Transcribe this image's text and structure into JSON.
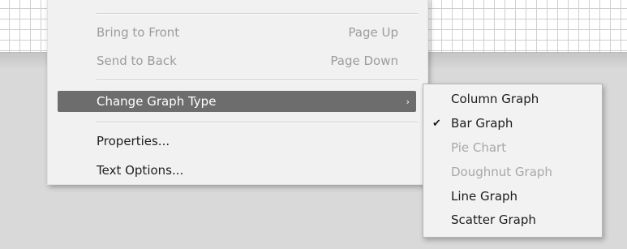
{
  "context_menu": {
    "items": [
      {
        "label": "Bring to Front",
        "shortcut": "Page Up",
        "enabled": false
      },
      {
        "label": "Send to Back",
        "shortcut": "Page Down",
        "enabled": false
      },
      {
        "label": "Change Graph Type",
        "shortcut": "",
        "enabled": true,
        "highlighted": true,
        "submenu_arrow": "›"
      },
      {
        "label": "Properties...",
        "shortcut": "",
        "enabled": true
      },
      {
        "label": "Text Options...",
        "shortcut": "",
        "enabled": true
      }
    ]
  },
  "graph_type_submenu": {
    "items": [
      {
        "label": "Column Graph",
        "enabled": true,
        "checked": false
      },
      {
        "label": "Bar Graph",
        "enabled": true,
        "checked": true,
        "check_mark": "✔"
      },
      {
        "label": "Pie Chart",
        "enabled": false,
        "checked": false
      },
      {
        "label": "Doughnut Graph",
        "enabled": false,
        "checked": false
      },
      {
        "label": "Line Graph",
        "enabled": true,
        "checked": false
      },
      {
        "label": "Scatter Graph",
        "enabled": true,
        "checked": false
      }
    ]
  },
  "colors": {
    "highlight": "#6d6d6d",
    "disabled_text": "#9c9c9c",
    "menu_background": "#f1f1f1"
  }
}
